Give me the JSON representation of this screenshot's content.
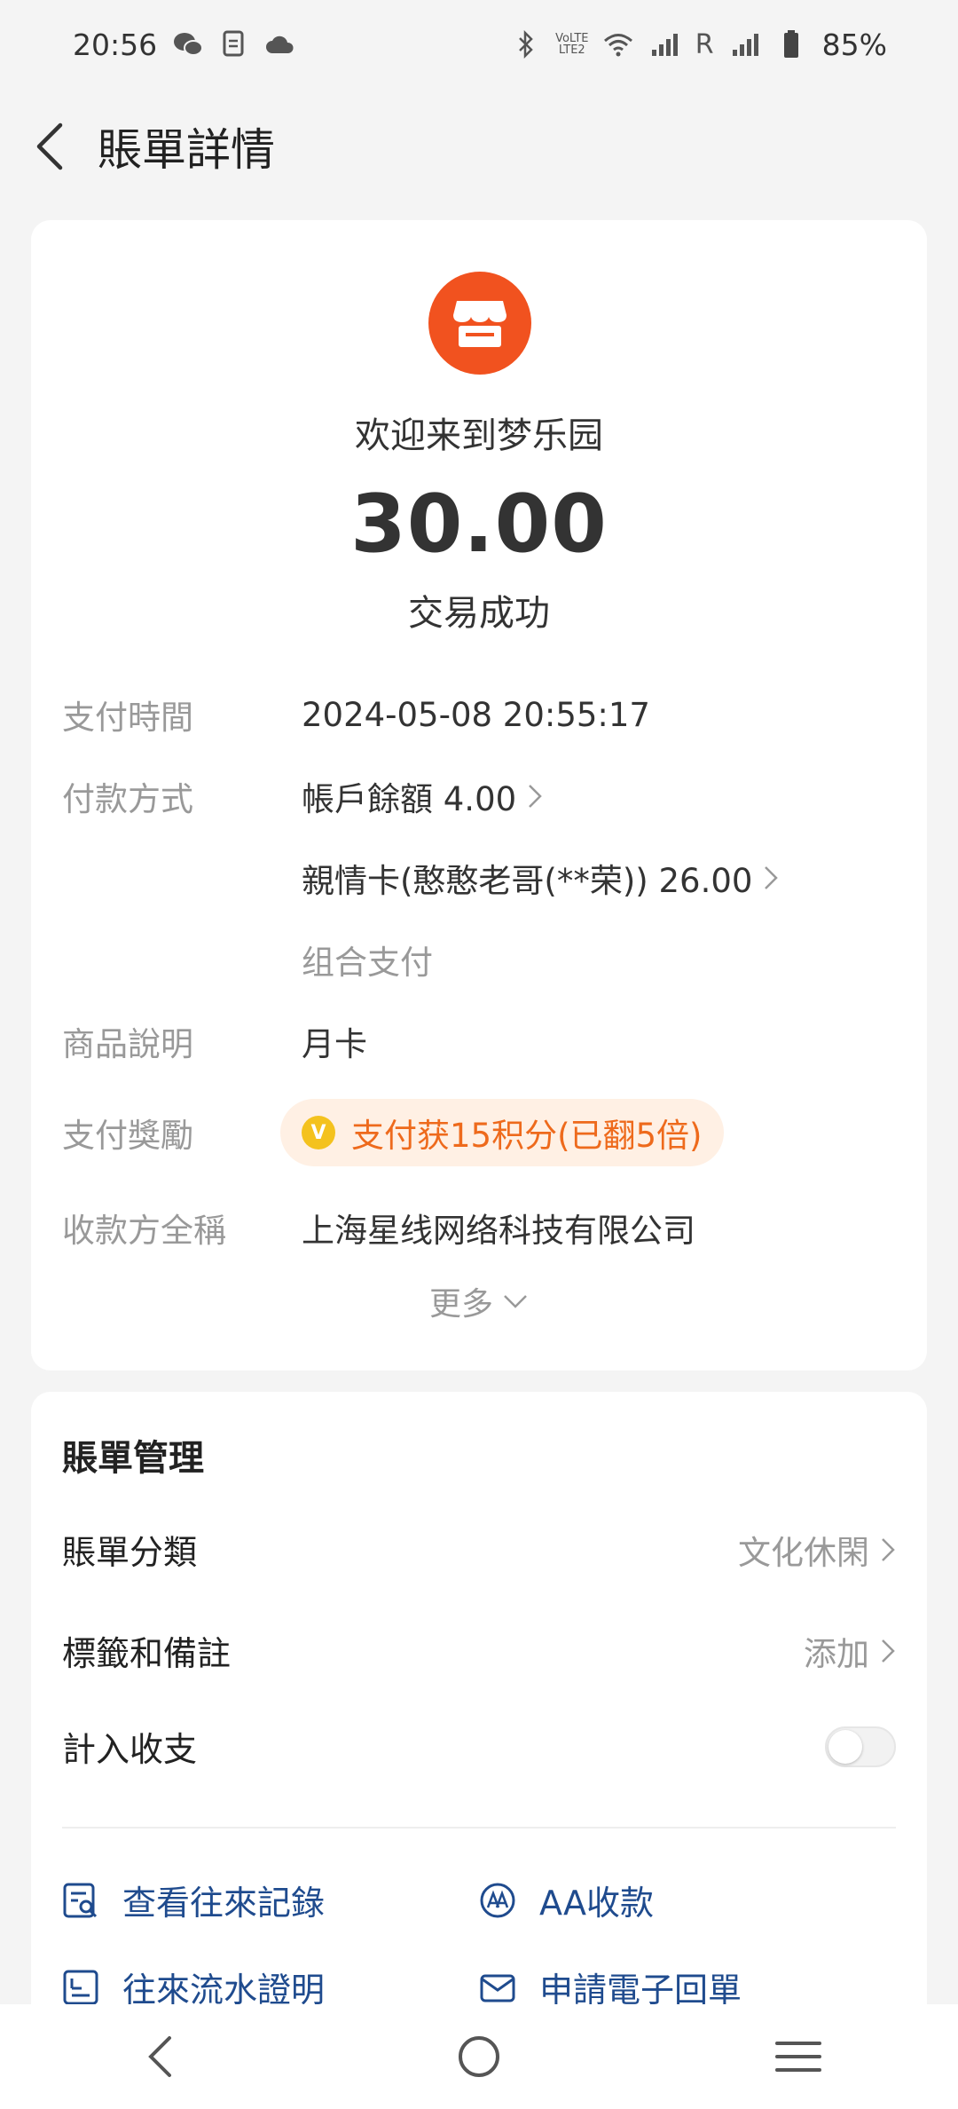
{
  "status_bar": {
    "time": "20:56",
    "battery": "85%",
    "roaming": "R",
    "left_icons": [
      "wechat-icon",
      "document-icon",
      "cloud-icon"
    ],
    "right_icons": [
      "bluetooth-icon",
      "volte-icon",
      "wifi-icon",
      "signal-icon",
      "signal-icon",
      "battery-icon"
    ]
  },
  "header": {
    "title": "賬單詳情"
  },
  "transaction": {
    "merchant_icon": "store-icon",
    "merchant_icon_color": "#f1521f",
    "merchant_name": "欢迎来到梦乐园",
    "amount": "30.00",
    "status": "交易成功",
    "details": {
      "pay_time_label": "支付時間",
      "pay_time_value": "2024-05-08 20:55:17",
      "pay_method_label": "付款方式",
      "pay_method_1": "帳戶餘額 4.00",
      "pay_method_2": "親情卡(憨憨老哥(**荣)) 26.00",
      "pay_method_combined": "组合支付",
      "product_label": "商品說明",
      "product_value": "月卡",
      "reward_label": "支付獎勵",
      "reward_value": "支付获15积分(已翻5倍)",
      "payee_label": "收款方全稱",
      "payee_value": "上海星线网络科技有限公司"
    },
    "more_label": "更多"
  },
  "manage": {
    "title": "賬單管理",
    "category_label": "賬單分類",
    "category_value": "文化休閑",
    "tags_label": "標籤和備註",
    "tags_value": "添加",
    "include_label": "計入收支",
    "include_enabled": false,
    "links": {
      "records": "查看往來記錄",
      "aa": "AA收款",
      "statement": "往來流水證明",
      "receipt": "申請電子回單"
    }
  },
  "accent_color": "#1f4b8e",
  "reward_color": "#ee6a1c"
}
